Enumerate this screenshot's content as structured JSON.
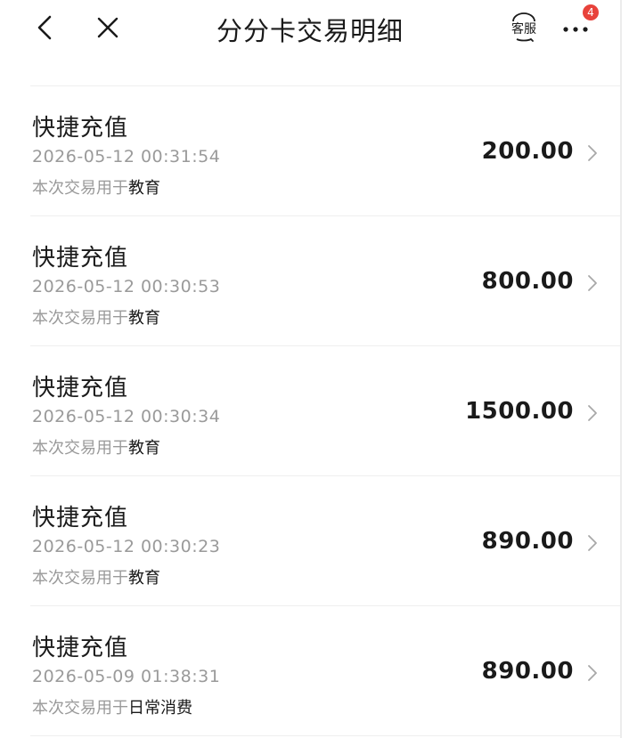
{
  "header": {
    "title": "分分卡交易明细",
    "service_label": "客服",
    "notification_count": "4"
  },
  "icons": {
    "back": "chevron-left-icon",
    "close": "close-icon",
    "service": "headset-icon",
    "more": "more-dots-icon",
    "row_arrow": "chevron-right-icon"
  },
  "colors": {
    "badge": "#e8423b",
    "muted_text": "#9a9a9a",
    "primary_text": "#1a1a1a"
  },
  "transactions": [
    {
      "title": "快捷充值",
      "time": "2026-05-12 00:31:54",
      "purpose_prefix": "本次交易用于",
      "category": "教育",
      "amount": "200.00"
    },
    {
      "title": "快捷充值",
      "time": "2026-05-12 00:30:53",
      "purpose_prefix": "本次交易用于",
      "category": "教育",
      "amount": "800.00"
    },
    {
      "title": "快捷充值",
      "time": "2026-05-12 00:30:34",
      "purpose_prefix": "本次交易用于",
      "category": "教育",
      "amount": "1500.00"
    },
    {
      "title": "快捷充值",
      "time": "2026-05-12 00:30:23",
      "purpose_prefix": "本次交易用于",
      "category": "教育",
      "amount": "890.00"
    },
    {
      "title": "快捷充值",
      "time": "2026-05-09 01:38:31",
      "purpose_prefix": "本次交易用于",
      "category": "日常消费",
      "amount": "890.00"
    }
  ]
}
